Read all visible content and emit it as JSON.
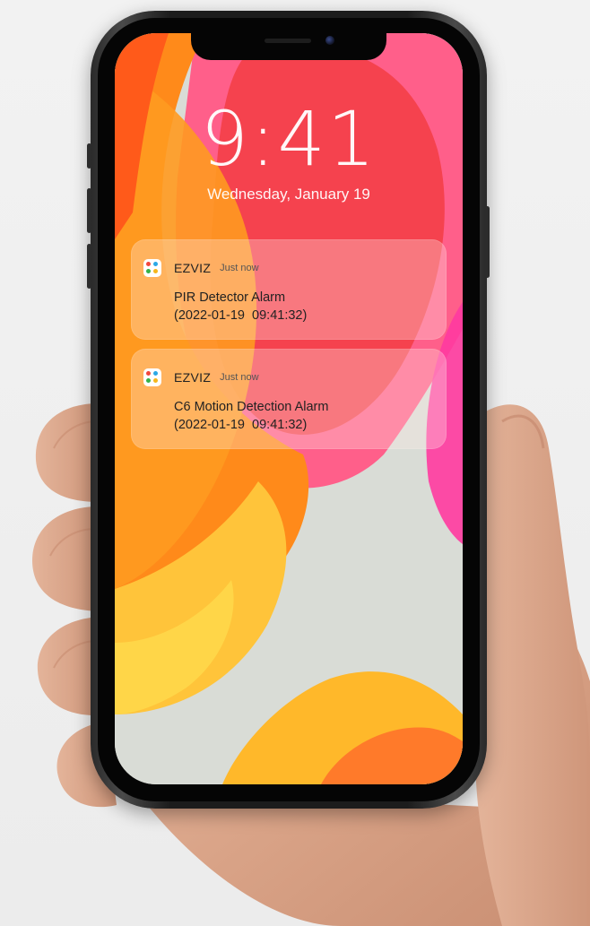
{
  "lockscreen": {
    "time": "9:41",
    "date": "Wednesday, January 19"
  },
  "notifications": [
    {
      "app_name": "EZVIZ",
      "time": "Just now",
      "title": "PIR Detector Alarm",
      "detail": "(2022-01-19  09:41:32)"
    },
    {
      "app_name": "EZVIZ",
      "time": "Just now",
      "title": "C6 Motion Detection Alarm",
      "detail": "(2022-01-19  09:41:32)"
    }
  ],
  "colors": {
    "wallpaper_base": "#d9dcd6",
    "wallpaper_orange": "#ff8a1a",
    "wallpaper_red": "#f5404f",
    "wallpaper_pink": "#ff5e9a",
    "wallpaper_yellow": "#ffce2e",
    "notification_bg": "rgba(255,235,230,0.32)",
    "ezviz_dot_1": "#f2463c",
    "ezviz_dot_2": "#2aa8e6",
    "ezviz_dot_3": "#35b24a",
    "ezviz_dot_4": "#f6b71c"
  },
  "icons": {
    "app_icon": "ezviz-logo-icon"
  }
}
